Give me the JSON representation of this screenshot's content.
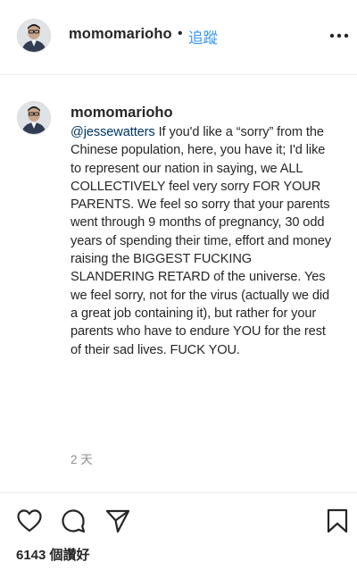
{
  "header": {
    "username": "momomarioho",
    "separator": "•",
    "follow_label": "追蹤",
    "more_icon": "more-horizontal-icon"
  },
  "comment": {
    "username": "momomarioho",
    "mention": "@jessewatters",
    "text": " If you'd like a “sorry” from the Chinese population, here, you have it; I'd like to represent our nation in saying, we ALL COLLECTIVELY feel very sorry FOR YOUR PARENTS. We feel so sorry that your parents went through 9 months of pregnancy, 30 odd years of spending their time, effort and money raising the BIGGEST FUCKING SLANDERING RETARD of the universe. Yes we feel sorry, not for the virus (actually we did a great job containing it), but rather for your parents who have to endure YOU for the rest of their sad lives. FUCK YOU.",
    "timestamp": "2 天"
  },
  "actions": {
    "like_icon": "heart-icon",
    "comment_icon": "comment-bubble-icon",
    "share_icon": "paper-plane-icon",
    "save_icon": "bookmark-icon",
    "likes_text": "6143 個讚好"
  },
  "colors": {
    "accent": "#3897f0",
    "mention": "#003569",
    "text": "#262626",
    "muted": "#8e8e8e",
    "divider": "#efefef"
  }
}
